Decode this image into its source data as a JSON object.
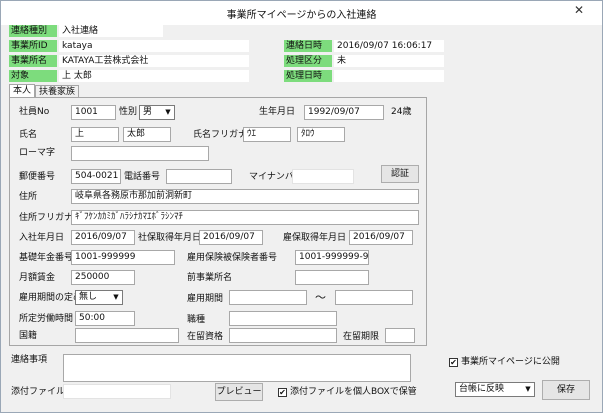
{
  "window": {
    "title": "事業所マイページからの入社連絡",
    "close_glyph": "✕"
  },
  "header": {
    "type_label": "連絡種別",
    "type_value": "入社連絡",
    "office_id_label": "事業所ID",
    "office_id_value": "kataya",
    "office_name_label": "事業所名",
    "office_name_value": "KATAYA工芸株式会社",
    "target_label": "対象",
    "target_value": "上 太郎",
    "contact_dt_label": "連絡日時",
    "contact_dt_value": "2016/09/07 16:06:17",
    "proc_label": "処理区分",
    "proc_value": "未",
    "proc_dt_label": "処理日時",
    "proc_dt_value": ""
  },
  "tabs": [
    "本人",
    "扶養家族"
  ],
  "form": {
    "emp_no_label": "社員No",
    "emp_no_value": "1001",
    "sex_label": "性別",
    "sex_value": "男",
    "birth_label": "生年月日",
    "birth_value": "1992/09/07",
    "age_text": "24歳",
    "name_label": "氏名",
    "last_name": "上",
    "first_name": "太郎",
    "kana_label": "氏名フリガナ",
    "last_kana": "ｳｴ",
    "first_kana": "ﾀﾛｳ",
    "romaji_label": "ローマ字",
    "romaji_value": "",
    "postal_label": "郵便番号",
    "postal_value": "504-0021",
    "phone_label": "電話番号",
    "phone_value": "",
    "mynumber_label": "マイナンバー",
    "mynumber_value": "",
    "auth_button": "認証",
    "address_label": "住所",
    "address_value": "岐阜県各務原市那加前洞新町",
    "address_kana_label": "住所フリガナ",
    "address_kana_value": "ｷﾞﾌｹﾝｶｶﾐｶﾞﾊﾗｼﾅｶﾏｴﾎﾞﾗｼﾝﾏﾁ",
    "join_date_label": "入社年月日",
    "join_date_value": "2016/09/07",
    "social_date_label": "社保取得年月日",
    "social_date_value": "2016/09/07",
    "emp_ins_date_label": "雇保取得年月日",
    "emp_ins_date_value": "2016/09/07",
    "pension_label": "基礎年金番号",
    "pension_value": "1001-999999",
    "emp_ins_no_label": "雇用保険被保険者番号",
    "emp_ins_no_value": "1001-999999-9",
    "wage_label": "月額賃金",
    "wage_value": "250000",
    "prev_office_label": "前事業所名",
    "prev_office_value": "",
    "term_label": "雇用期間の定め",
    "term_value": "無し",
    "period_label": "雇用期間",
    "period_from": "",
    "period_sep": "～",
    "period_to": "",
    "hours_label": "所定労働時間",
    "hours_value": "50:00",
    "job_label": "職種",
    "job_value": "",
    "nationality_label": "国籍",
    "nationality_value": "",
    "status_label": "在留資格",
    "status_value": "",
    "stay_label": "在留期限",
    "stay_value": ""
  },
  "right": {
    "publish_label": "事業所マイページに公開",
    "publish_checked": "✔"
  },
  "footer": {
    "message_label": "連絡事項",
    "message_value": "",
    "attach_label": "添付ファイル",
    "attach_value": "",
    "preview_button": "プレビュー",
    "save_box_label": "添付ファイルを個人BOXで保管",
    "save_box_checked": "✔",
    "reflect_value": "台帳に反映",
    "save_button": "保存"
  }
}
